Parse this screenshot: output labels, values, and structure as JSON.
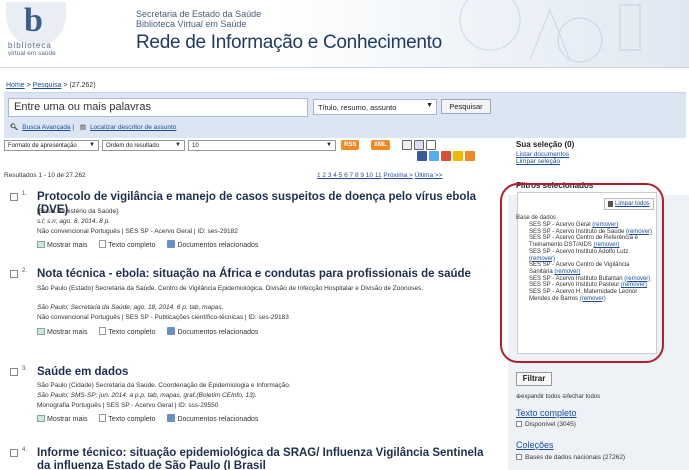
{
  "header": {
    "logo_letter": "b",
    "logo_line1": "biblioteca",
    "logo_line2": "virtual em saúde",
    "line1": "Secretaria de Estado da Saúde",
    "line2": "Biblioteca Virtual em Saúde",
    "title": "Rede de Informação e Conhecimento"
  },
  "breadcrumb": {
    "home": "Home",
    "sep1": " > ",
    "search": "Pesquisa",
    "sep2": " > ",
    "count": "(27.262)"
  },
  "search": {
    "placeholder": "Entre uma ou mais palavras",
    "field": "Título, resumo, assunto",
    "button": "Pesquisar",
    "advanced": "Busca Avançada",
    "sep": "|",
    "decs": "Localizar descritor de assunto"
  },
  "toolbar": {
    "format": "Formato de apresentação",
    "order": "Ordem do resultado",
    "per_page": "10",
    "rss": "RSS",
    "xml": "XML"
  },
  "results_info": "Resultados 1 - 10 de 27.262",
  "pager": {
    "pages": "1 2 3 4 5 6 7 8 9 10 11",
    "next": "Próxima >",
    "last": "Última >>"
  },
  "results": [
    {
      "num": "1.",
      "title": "Protocolo de vigilância e manejo de casos suspeitos de doença pelo vírus ebola (DVE)",
      "authors": "[Brasil. Ministério da Saúde].",
      "source": "s.l; s.n; ago. 8, 2014. 8 p.",
      "meta": "Não convencional Português | SES SP - Acervo Geral | ID: ses-29182"
    },
    {
      "num": "2.",
      "title": "Nota técnica - ebola: situação na África e condutas para profissionais de saúde",
      "authors": "São Paulo (Estado) Secretaria da Saúde. Centro de Vigilância Epidemiológica. Divisão de Infecção Hospitalar e Divisão de Zoonoses.",
      "source": "São Paulo; Secretaria da Saúde; ago. 18, 2014. 6 p. tab, mapas.",
      "meta": "Não convencional Português | SES SP - Publicações científico-técnicas | ID: ses-29183"
    },
    {
      "num": "3.",
      "title": "Saúde em dados",
      "authors": "São Paulo (Cidade) Secretaria da Saúde. Coordenação de Epidemiologia e Informação.",
      "source": "São Paulo; SMS-SP; jun. 2014. a p.p. tab, mapas, graf.(Boletim CEInfo, 13).",
      "meta": "Monografia Português | SES SP - Acervo Geral | ID: sss-29550"
    },
    {
      "num": "4.",
      "title": "Informe técnico: situação epidemiológica da SRAG/ Influenza Vigilância Sentinela da influenza Estado de São Paulo (I Brasil"
    }
  ],
  "actions": {
    "more": "Mostrar mais",
    "full": "Texto completo",
    "related": "Documentos relacionados"
  },
  "sidebar": {
    "selection_title": "Sua seleção (0)",
    "list_docs": "Listar documentos",
    "clear_selection": "Limpar seleção",
    "filters_title": "Filtros selecionados",
    "clear_all": "Limpar todos",
    "db_label": "Base de dados",
    "filters": [
      {
        "name": "SES SP - Acervo Geral",
        "remove": "(remover)"
      },
      {
        "name": "SES SP - Acervo Instituto de Saúde",
        "remove": "(remover)"
      },
      {
        "name": "SES SP - Acervo Centro de Referência e Treinamento DST/AIDS",
        "remove": "(remover)"
      },
      {
        "name": "SES SP - Acervo Instituto Adolfo Lutz",
        "remove": "(remover)"
      },
      {
        "name": "SES SP - Acervo Centro de Vigilância Sanitária",
        "remove": "(remover)"
      },
      {
        "name": "SES SP - Acervo Instituto Butantan",
        "remove": "(remover)"
      },
      {
        "name": "SES SP - Acervo Instituto Pasteur",
        "remove": "(remover)"
      },
      {
        "name": "SES SP - Acervo H. Maternidade Leonor Mendes de Barros",
        "remove": "(remover)"
      }
    ],
    "filter_button": "Filtrar",
    "expand": "expandir todos",
    "collapse": "fechar todos",
    "full_text_title": "Texto completo",
    "available": "Disponível (3045)",
    "collections_title": "Coleções",
    "national_db": "Bases de dados nacionais (27262)"
  },
  "colors": {
    "accent": "#1a4d9c",
    "oval": "#b1202a",
    "search_bg": "#dce6f2"
  }
}
